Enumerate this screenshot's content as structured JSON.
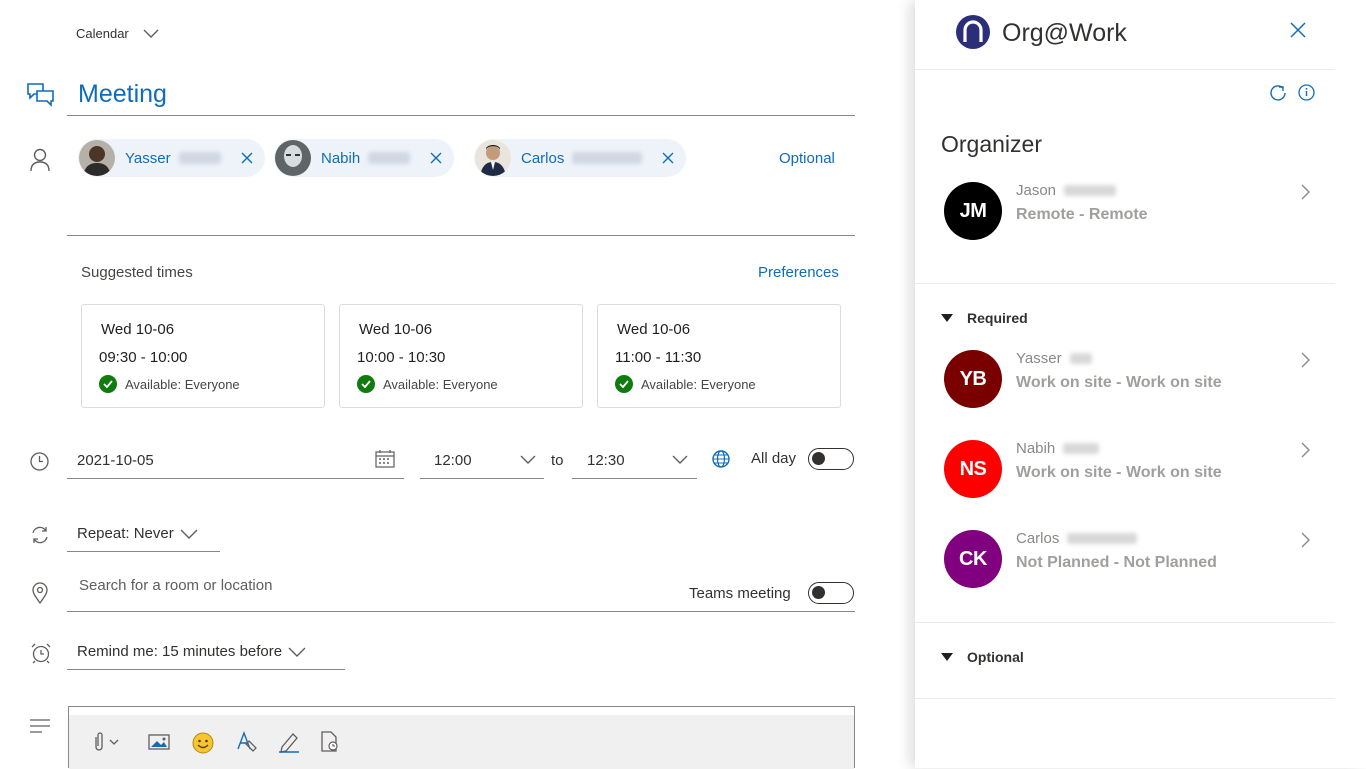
{
  "compose": {
    "calendar_label": "Calendar",
    "title": "Meeting",
    "attendees": [
      {
        "name": "Yasser"
      },
      {
        "name": "Nabih"
      },
      {
        "name": "Carlos"
      }
    ],
    "optional_link": "Optional",
    "suggested_label": "Suggested times",
    "preferences_link": "Preferences",
    "suggestions": [
      {
        "date": "Wed 10-06",
        "time": "09:30 - 10:00",
        "status": "Available: Everyone"
      },
      {
        "date": "Wed 10-06",
        "time": "10:00 - 10:30",
        "status": "Available: Everyone"
      },
      {
        "date": "Wed 10-06",
        "time": "11:00 - 11:30",
        "status": "Available: Everyone"
      }
    ],
    "date": "2021-10-05",
    "start_time": "12:00",
    "to_label": "to",
    "end_time": "12:30",
    "all_day_label": "All day",
    "all_day_on": false,
    "repeat": "Repeat:  Never",
    "location_placeholder": "Search for a room or location",
    "teams_label": "Teams meeting",
    "teams_on": false,
    "remind": "Remind me:  15 minutes before"
  },
  "panel": {
    "title": "Org@Work",
    "organizer_heading": "Organizer",
    "organizer": {
      "initials": "JM",
      "name": "Jason",
      "status": "Remote - Remote",
      "color": "#000000"
    },
    "required_heading": "Required",
    "required": [
      {
        "initials": "YB",
        "name": "Yasser",
        "status": "Work on site - Work on site",
        "color": "#7a0000"
      },
      {
        "initials": "NS",
        "name": "Nabih",
        "status": "Work on site - Work on site",
        "color": "#ff0000"
      },
      {
        "initials": "CK",
        "name": "Carlos",
        "status": "Not Planned - Not Planned",
        "color": "#800080"
      }
    ],
    "optional_heading": "Optional"
  },
  "colors": {
    "accent": "#0f6cbd",
    "available": "#107c10"
  }
}
